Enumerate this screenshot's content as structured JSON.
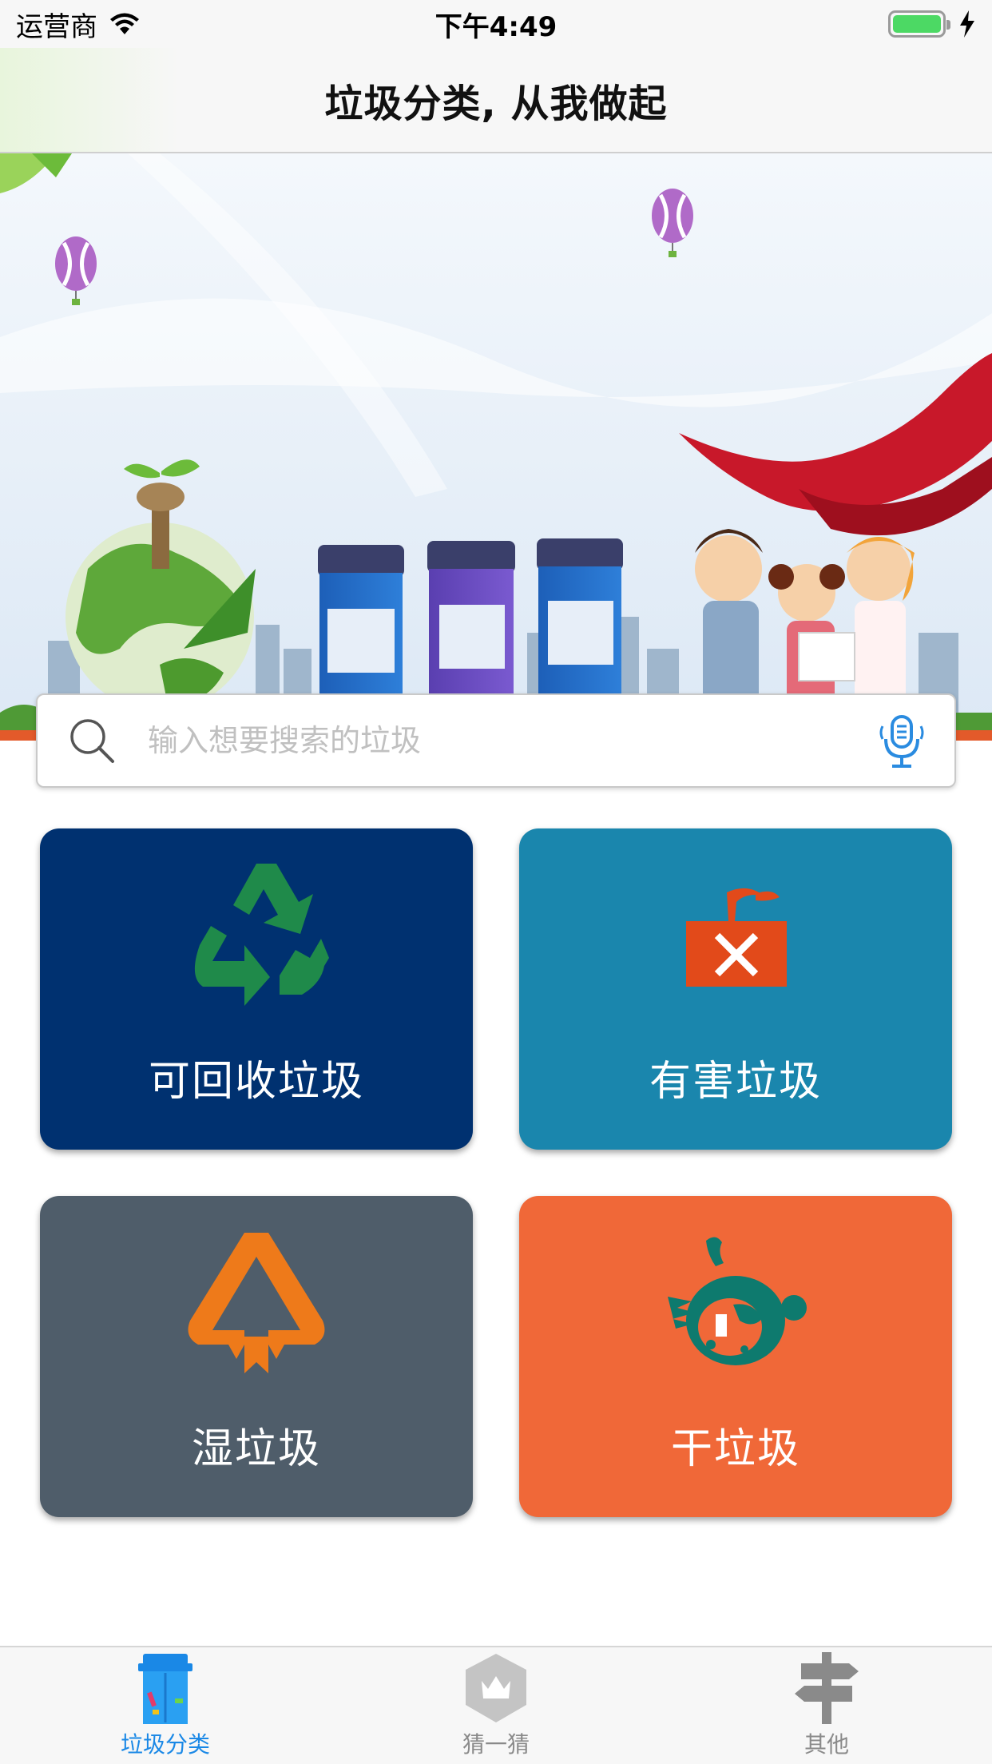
{
  "status_bar": {
    "carrier": "运营商",
    "time": "下午4:49",
    "battery_color": "#4cd964"
  },
  "nav": {
    "title": "垃圾分类, 从我做起"
  },
  "search": {
    "placeholder": "输入想要搜索的垃圾"
  },
  "categories": [
    {
      "label": "可回收垃圾",
      "color": "#003170",
      "icon": "recycle-icon"
    },
    {
      "label": "有害垃圾",
      "color": "#1a86ad",
      "icon": "hazardous-icon"
    },
    {
      "label": "湿垃圾",
      "color": "#4f5d6a",
      "icon": "wet-waste-icon"
    },
    {
      "label": "干垃圾",
      "color": "#f06838",
      "icon": "dry-waste-icon"
    }
  ],
  "tabs": [
    {
      "label": "垃圾分类",
      "icon": "trash-bin-icon",
      "active": true
    },
    {
      "label": "猜一猜",
      "icon": "crown-badge-icon",
      "active": false
    },
    {
      "label": "其他",
      "icon": "signpost-icon",
      "active": false
    }
  ],
  "colors": {
    "tab_active": "#1a88e6",
    "tab_inactive": "#8a8a8a"
  }
}
